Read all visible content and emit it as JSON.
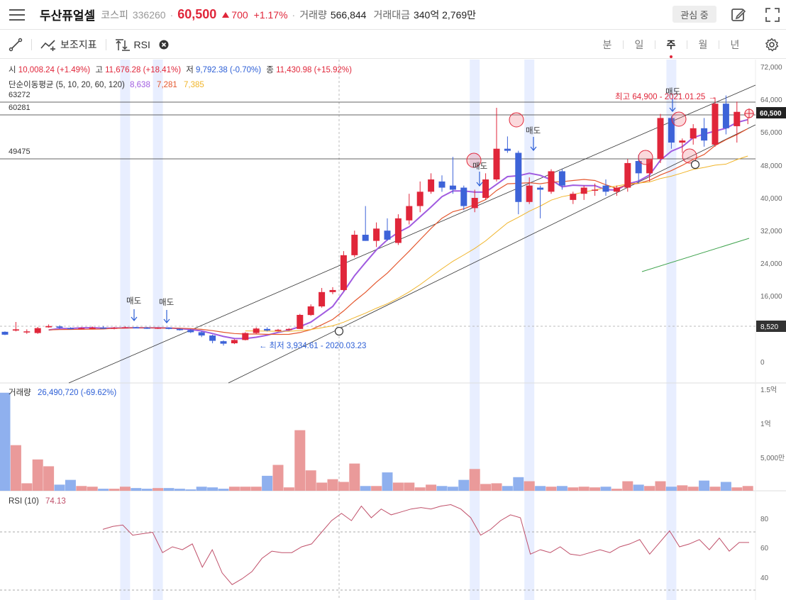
{
  "header": {
    "stock_name": "두산퓨얼셀",
    "market": "코스피",
    "code": "336260",
    "price": "60,500",
    "change": "700",
    "change_pct": "+1.17%",
    "volume_label": "거래량",
    "volume": "566,844",
    "amount_label": "거래대금",
    "amount": "340억 2,769만",
    "watch_label": "관심 중"
  },
  "toolbar": {
    "indicator_label": "보조지표",
    "rsi_label": "RSI",
    "periods": [
      "분",
      "일",
      "주",
      "월",
      "년"
    ],
    "active_period": "주"
  },
  "price_panel": {
    "ohlc": {
      "open_label": "시",
      "open": "10,008.24 (+1.49%)",
      "high_label": "고",
      "high": "11,676.28 (+18.41%)",
      "low_label": "저",
      "low": "9,792.38 (-0.70%)",
      "close_label": "종",
      "close": "11,430.98 (+15.92%)"
    },
    "ma_label": "단순이동평균 (5, 10, 20, 60, 120)",
    "ma_values": [
      "8,638",
      "7,281",
      "7,385"
    ],
    "hlines": [
      "63272",
      "60281",
      "49475"
    ],
    "high_annotation": "최고 64,900 - 2021.01.25",
    "low_annotation": "최저 3,934.61 - 2020.03.23",
    "sell_label": "매도",
    "last_price_tag": "60,500",
    "cursor_price_tag": "8,520",
    "y_ticks": [
      "72,000",
      "64,000",
      "56,000",
      "48,000",
      "40,000",
      "32,000",
      "24,000",
      "16,000",
      "0"
    ]
  },
  "volume_panel": {
    "label": "거래량",
    "value": "26,490,720 (-69.62%)",
    "y_ticks": [
      "1.5억",
      "1억",
      "5,000만"
    ]
  },
  "rsi_panel": {
    "label": "RSI (10)",
    "value": "74.13",
    "y_ticks": [
      "80",
      "60",
      "40"
    ]
  },
  "colors": {
    "up": "#e0263a",
    "down": "#3d63d8",
    "ma5": "#a05be0",
    "ma10": "#e4572e",
    "ma20": "#f0b429",
    "ma60": "#3fa34d",
    "rsi": "#c0506a",
    "highlight": "#e8eeff"
  },
  "chart_data": {
    "type": "candlestick",
    "candles": [
      [
        7300,
        7400,
        6500,
        6600
      ],
      [
        7600,
        9700,
        7400,
        7900
      ],
      [
        7200,
        7900,
        6800,
        7400
      ],
      [
        7000,
        8500,
        6800,
        8200
      ],
      [
        8400,
        9100,
        8300,
        8700
      ],
      [
        8600,
        8900,
        8000,
        8300
      ],
      [
        8200,
        8400,
        7900,
        8000
      ],
      [
        8000,
        8400,
        7900,
        8200
      ],
      [
        8200,
        8600,
        8000,
        8300
      ],
      [
        8300,
        8700,
        8100,
        8200
      ],
      [
        8200,
        8500,
        7900,
        8300
      ],
      [
        8300,
        8600,
        8200,
        8400
      ],
      [
        8400,
        8500,
        8200,
        8300
      ],
      [
        8300,
        8500,
        8000,
        8100
      ],
      [
        8100,
        8400,
        8000,
        8300
      ],
      [
        8300,
        8400,
        7900,
        8000
      ],
      [
        8000,
        8100,
        7600,
        7700
      ],
      [
        7700,
        8000,
        7000,
        7200
      ],
      [
        7200,
        7500,
        6000,
        6400
      ],
      [
        6400,
        6600,
        4500,
        5100
      ],
      [
        5000,
        5200,
        3934,
        4400
      ],
      [
        4500,
        5500,
        4300,
        5300
      ],
      [
        5300,
        7200,
        5200,
        7000
      ],
      [
        7000,
        8400,
        6800,
        8100
      ],
      [
        8000,
        8400,
        7400,
        7600
      ],
      [
        7600,
        8000,
        7400,
        7800
      ],
      [
        7800,
        8200,
        7600,
        8000
      ],
      [
        8000,
        11676,
        9792,
        11430
      ],
      [
        11400,
        14000,
        11200,
        13500
      ],
      [
        13500,
        18000,
        13200,
        17000
      ],
      [
        17000,
        18200,
        16500,
        17500
      ],
      [
        17500,
        27000,
        17200,
        26000
      ],
      [
        26000,
        32000,
        25500,
        31000
      ],
      [
        31000,
        38000,
        30500,
        29500
      ],
      [
        29500,
        34000,
        28000,
        32500
      ],
      [
        32000,
        35000,
        29500,
        29800
      ],
      [
        29000,
        36000,
        28500,
        35000
      ],
      [
        34500,
        41000,
        33500,
        38000
      ],
      [
        38000,
        44000,
        36500,
        41500
      ],
      [
        41500,
        46000,
        41000,
        44500
      ],
      [
        44000,
        45500,
        41500,
        42500
      ],
      [
        43000,
        50000,
        41000,
        42000
      ],
      [
        42500,
        43000,
        37000,
        38000
      ],
      [
        37500,
        42000,
        36500,
        40000
      ],
      [
        40000,
        46000,
        39500,
        44500
      ],
      [
        44500,
        62000,
        44000,
        52000
      ],
      [
        52000,
        55000,
        51000,
        51500
      ],
      [
        51000,
        51500,
        36000,
        39000
      ],
      [
        39000,
        45000,
        38500,
        43000
      ],
      [
        42500,
        43000,
        35000,
        42000
      ],
      [
        41500,
        47000,
        41000,
        46500
      ],
      [
        46500,
        47000,
        42000,
        43000
      ],
      [
        39500,
        41500,
        38500,
        41000
      ],
      [
        41000,
        43000,
        39500,
        42500
      ],
      [
        42000,
        43500,
        40500,
        42000
      ],
      [
        43000,
        44500,
        40500,
        41500
      ],
      [
        41500,
        43000,
        40500,
        42500
      ],
      [
        42500,
        49500,
        41500,
        48500
      ],
      [
        49000,
        50500,
        43500,
        46000
      ],
      [
        46000,
        48500,
        44000,
        49500
      ],
      [
        49500,
        60500,
        48500,
        59500
      ],
      [
        59500,
        60000,
        52000,
        53500
      ],
      [
        53500,
        54500,
        51000,
        54000
      ],
      [
        54500,
        58000,
        53000,
        57000
      ],
      [
        57000,
        59500,
        52500,
        54000
      ],
      [
        53000,
        64500,
        52500,
        63000
      ],
      [
        63000,
        65000,
        55500,
        57000
      ],
      [
        57500,
        63500,
        53500,
        61000
      ],
      [
        60000,
        61000,
        58000,
        60500
      ]
    ],
    "volume_millions": [
      144,
      67,
      11,
      46,
      36,
      9,
      16,
      7,
      6,
      3,
      3,
      6,
      4,
      3,
      4,
      4,
      3,
      2,
      6,
      5,
      3,
      6,
      6,
      6,
      22,
      38,
      5,
      89,
      30,
      12,
      17,
      13,
      40,
      7,
      7,
      27,
      12,
      12,
      5,
      9,
      7,
      6,
      16,
      32,
      10,
      11,
      7,
      20,
      14,
      7,
      6,
      7,
      5,
      6,
      5,
      6,
      3,
      14,
      9,
      7,
      14,
      6,
      8,
      6,
      15,
      6,
      13,
      5,
      7
    ],
    "rsi_series": [
      72,
      74,
      75,
      68,
      69,
      70,
      56,
      60,
      58,
      62,
      46,
      58,
      42,
      34,
      38,
      43,
      52,
      57,
      56,
      56,
      60,
      62,
      70,
      78,
      83,
      78,
      88,
      80,
      86,
      82,
      84,
      86,
      87,
      86,
      88,
      89,
      86,
      80,
      68,
      72,
      78,
      82,
      80,
      55,
      58,
      56,
      60,
      55,
      54,
      56,
      58,
      56,
      60,
      62,
      65,
      55,
      63,
      71,
      60,
      62,
      65,
      58,
      66,
      57,
      63,
      63
    ],
    "price_ylim": [
      0,
      75000
    ],
    "volume_ylim": [
      0,
      160
    ],
    "rsi_ylim": [
      30,
      100
    ]
  }
}
